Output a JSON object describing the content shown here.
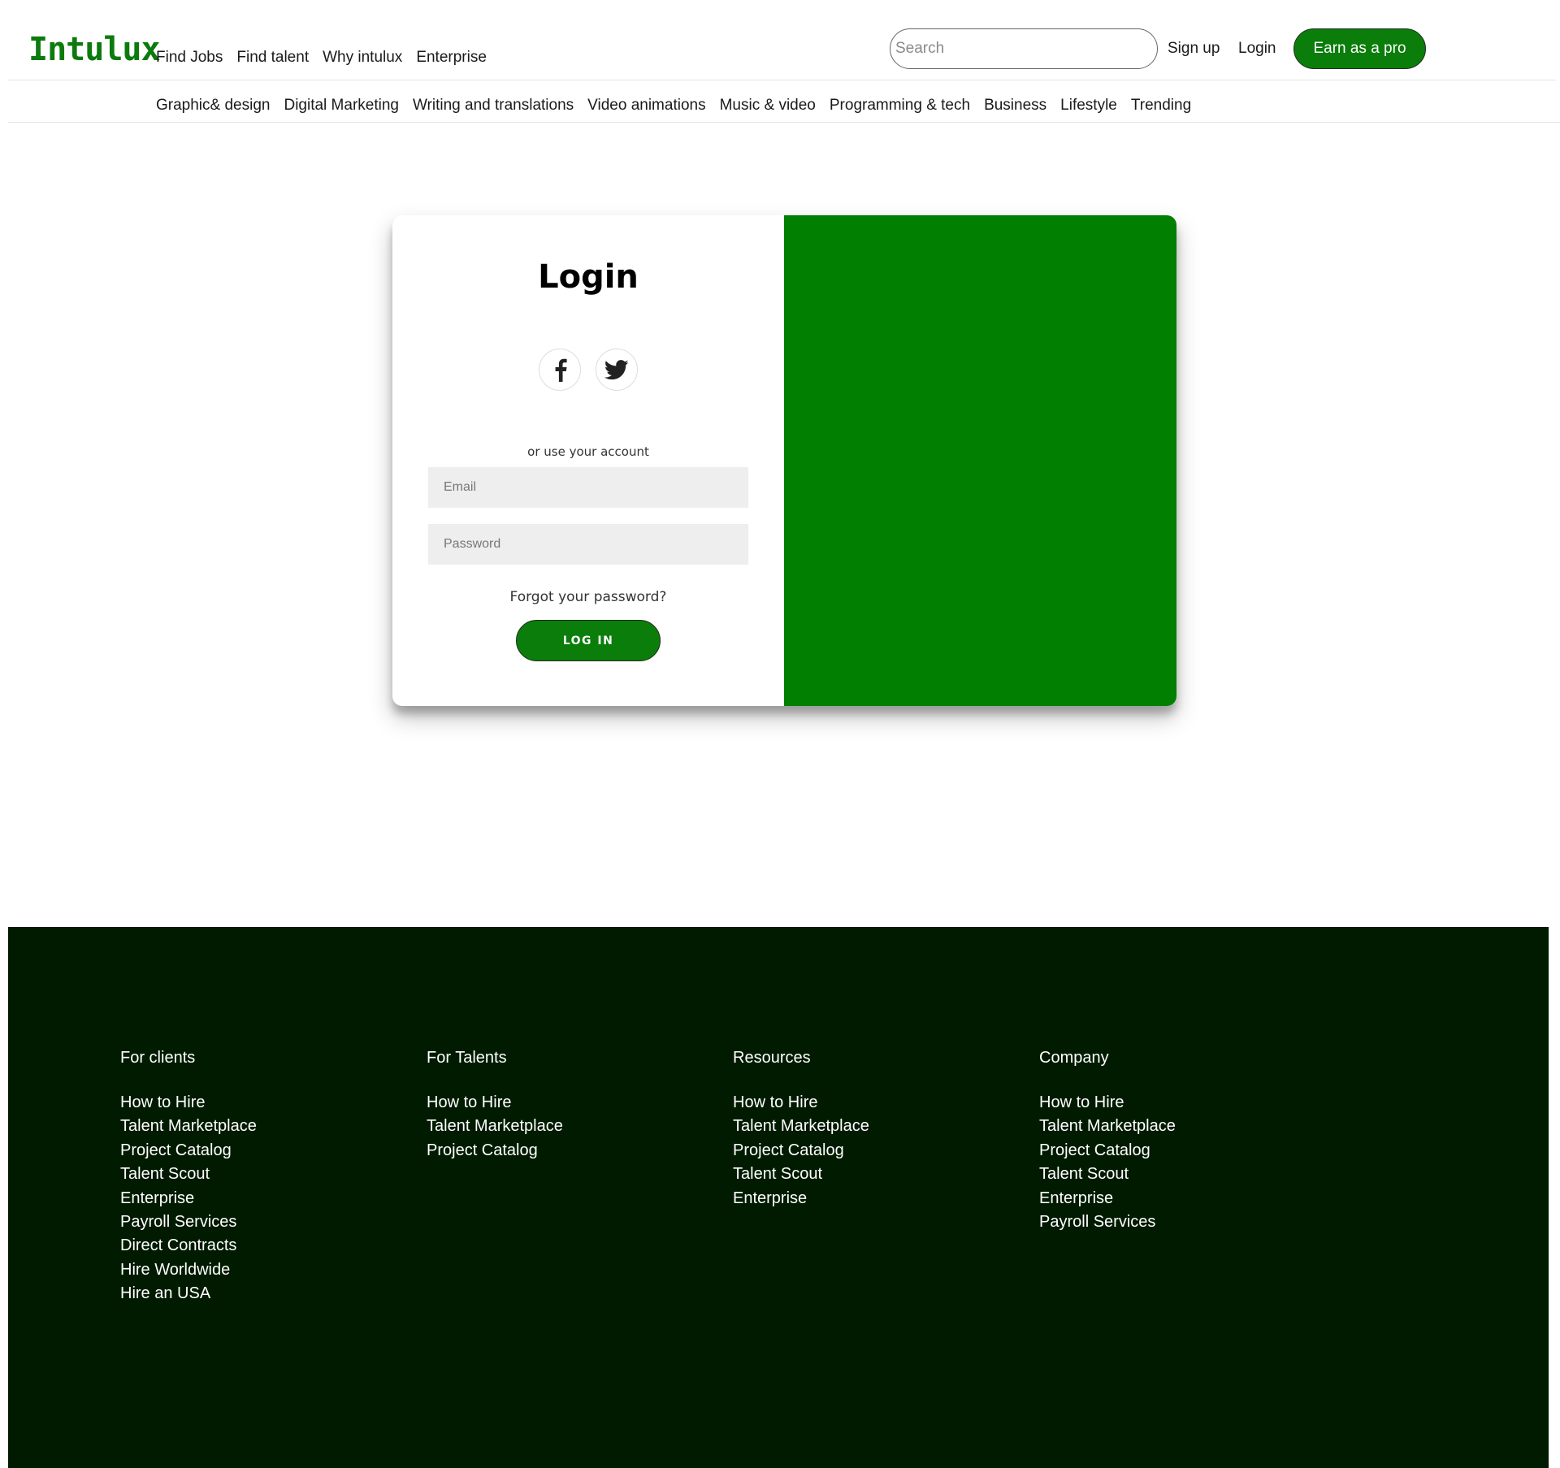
{
  "header": {
    "logo": "Intulux",
    "nav": [
      "Find Jobs",
      "Find talent",
      "Why intulux",
      "Enterprise"
    ],
    "search_placeholder": "Search",
    "signup_label": "Sign up",
    "login_label": "Login",
    "pro_button": "Earn as a pro",
    "accent_color": "#0a7d0a"
  },
  "categories": [
    "Graphic& design",
    "Digital Marketing",
    "Writing and translations",
    "Video animations",
    "Music & video",
    "Programming & tech",
    "Business",
    "Lifestyle",
    "Trending"
  ],
  "login": {
    "title": "Login",
    "socials": [
      "facebook-icon",
      "twitter-icon"
    ],
    "or_text": "or use your account",
    "email_placeholder": "Email",
    "password_placeholder": "Password",
    "forgot": "Forgot your password?",
    "button": "LOG IN",
    "panel_color": "#007f00"
  },
  "footer": {
    "background": "#001b00",
    "columns": [
      {
        "title": "For clients",
        "links": [
          "How to Hire",
          "Talent Marketplace",
          "Project Catalog",
          "Talent Scout",
          "Enterprise",
          "Payroll Services",
          "Direct Contracts",
          "Hire Worldwide",
          "Hire an USA"
        ]
      },
      {
        "title": "For Talents",
        "links": [
          "How to Hire",
          "Talent Marketplace",
          "Project Catalog"
        ]
      },
      {
        "title": "Resources",
        "links": [
          "How to Hire",
          "Talent Marketplace",
          "Project Catalog",
          "Talent Scout",
          "Enterprise"
        ]
      },
      {
        "title": "Company",
        "links": [
          "How to Hire",
          "Talent Marketplace",
          "Project Catalog",
          "Talent Scout",
          "Enterprise",
          "Payroll Services"
        ]
      }
    ]
  }
}
